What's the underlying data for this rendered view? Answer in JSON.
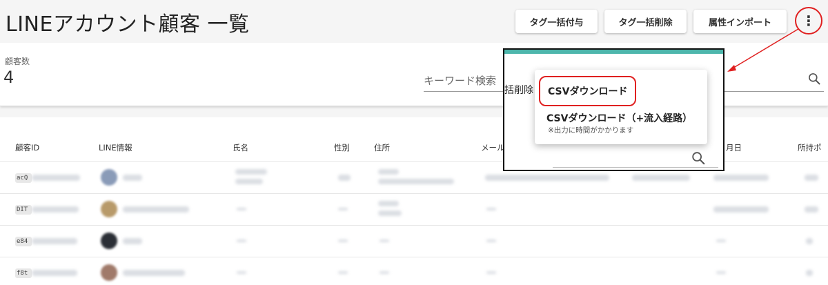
{
  "header": {
    "title": "LINEアカウント顧客 一覧",
    "buttons": [
      "タグ一括付与",
      "タグ一括削除",
      "属性インポート"
    ],
    "more_icon": "more-vert-icon"
  },
  "summary": {
    "count_label": "顧客数",
    "count_value": "4",
    "search_placeholder": "キーワード検索"
  },
  "table": {
    "columns": [
      "顧客ID",
      "LINE情報",
      "氏名",
      "性別",
      "住所",
      "メール",
      "月日",
      "所持ポ"
    ],
    "rows": [
      {
        "id": "acQ"
      },
      {
        "id": "DIT"
      },
      {
        "id": "e84"
      },
      {
        "id": "f8t"
      }
    ]
  },
  "overlay": {
    "partial_label": "括削除",
    "menu": {
      "item1": "CSVダウンロード",
      "item2": "CSVダウンロード（+流入経路）",
      "item2_note": "※出力に時間がかかります"
    }
  },
  "colors": {
    "annotation": "#e02020",
    "accent": "#4db6ac"
  }
}
